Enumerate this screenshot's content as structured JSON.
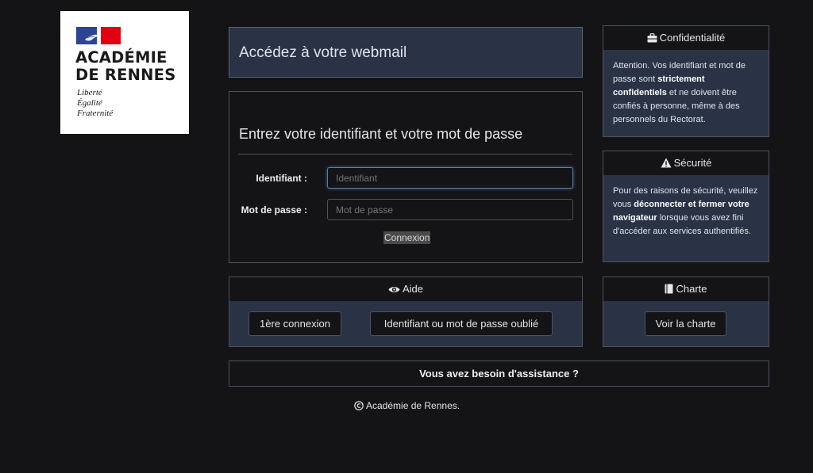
{
  "logo": {
    "title_line1": "ACADÉMIE",
    "title_line2": "DE RENNES",
    "motto_line1": "Liberté",
    "motto_line2": "Égalité",
    "motto_line3": "Fraternité"
  },
  "header": {
    "title": "Accédez à votre webmail"
  },
  "login": {
    "heading": "Entrez votre identifiant et votre mot de passe",
    "username_label": "Identifiant :",
    "username_placeholder": "Identifiant",
    "password_label": "Mot de passe :",
    "password_placeholder": "Mot de passe",
    "submit_label": "Connexion"
  },
  "confidentialite": {
    "icon": "briefcase-icon",
    "title": "Confidentialité",
    "text_1": "Attention. Vos identifiant et mot de passe sont ",
    "text_bold": "strictement confidentiels",
    "text_2": " et ne doivent être confiés à personne, même à des personnels du Rectorat."
  },
  "securite": {
    "icon": "warning-icon",
    "title": "Sécurité",
    "text_1": "Pour des raisons de sécurité, veuillez vous ",
    "text_bold": "déconnecter et fermer votre navigateur",
    "text_2": " lorsque vous avez fini d'accéder aux services authentifiés."
  },
  "aide": {
    "icon": "eye-icon",
    "title": "Aide",
    "button_first": "1ère connexion",
    "button_forgot": "Identifiant ou mot de passe oublié"
  },
  "charte": {
    "icon": "book-icon",
    "title": "Charte",
    "button": "Voir la charte"
  },
  "assistance": {
    "title": "Vous avez besoin d'assistance ?"
  },
  "footer": {
    "copyright_icon": "copyright-icon",
    "text": "Académie de Rennes."
  },
  "colors": {
    "background": "#141416",
    "panel_blue": "#2a3345",
    "border": "#4b5261",
    "flag_blue": "#2d4393",
    "flag_red": "#e1000f"
  }
}
